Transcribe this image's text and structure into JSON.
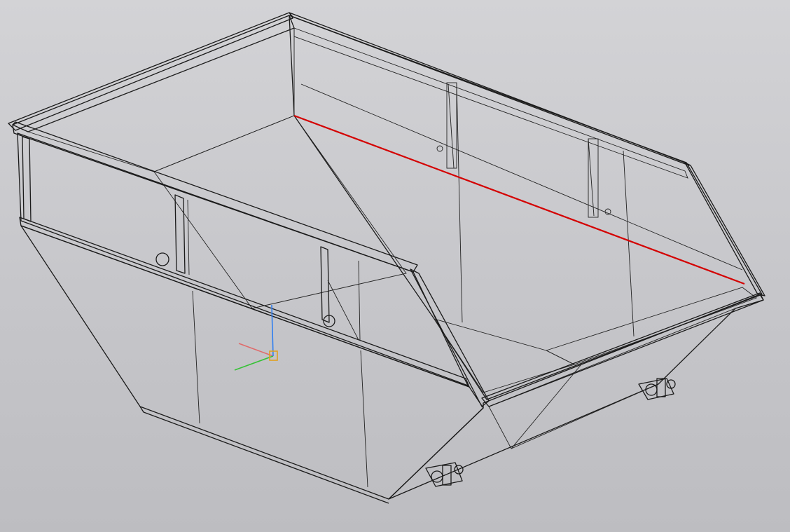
{
  "viewport": {
    "background": "#c9c9cc",
    "model": "skip-container"
  },
  "colors": {
    "wall_dark": "#5a5a5a",
    "wall_mid": "#646464",
    "wall_light": "#7a7a7a",
    "inner_light": "#9a9a9a",
    "floor": "#8a8a8a",
    "rim": "#b4b4b4",
    "edge": "#1a1a1a",
    "selected_edge": "#d40000",
    "axis_x": "#e06a6a",
    "axis_y": "#36c236",
    "axis_z": "#2f7ef0",
    "origin": "#e0a020"
  },
  "icons": {
    "origin_triad": "coordinate-triad-icon"
  }
}
